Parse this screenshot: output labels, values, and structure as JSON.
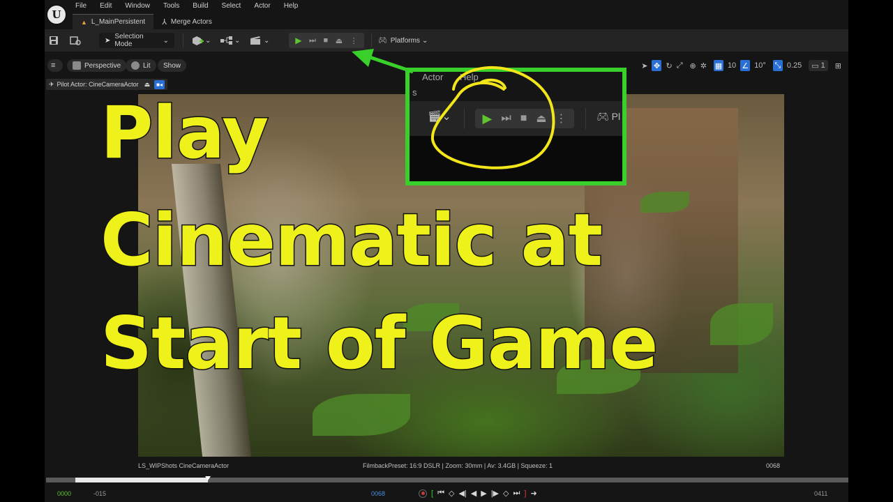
{
  "app": {
    "logo": "U",
    "menu": [
      "File",
      "Edit",
      "Window",
      "Tools",
      "Build",
      "Select",
      "Actor",
      "Help"
    ]
  },
  "tabs": [
    {
      "label": "L_MainPersistent",
      "icon": "warning-icon"
    },
    {
      "label": "Merge Actors",
      "icon": "merge-icon"
    }
  ],
  "toolbar": {
    "selection_mode": "Selection Mode",
    "platforms": "Platforms"
  },
  "viewport": {
    "perspective": "Perspective",
    "lit": "Lit",
    "show": "Show",
    "grid_value": "10",
    "angle_value": "10°",
    "scale_value": "0.25",
    "camera_value": "1",
    "pilot_actor": "Pilot Actor: CineCameraActor"
  },
  "status": {
    "shot": "LS_WIPShots  CineCameraActor",
    "filmback": "FilmbackPreset: 16:9 DSLR | Zoom: 30mm | Av: 3.4GB | Squeeze: 1",
    "frame": "0068"
  },
  "transport": {
    "start": "0000",
    "offset": "-015",
    "current": "0068",
    "end": "0411",
    "progress_fraction": 0.165
  },
  "callout": {
    "menu_a": "Actor",
    "menu_b": "Help",
    "stub": "s",
    "platforms_stub": "Pl"
  },
  "overlay": {
    "line1": "Play",
    "line2": "Cinematic at",
    "line3": "Start of Game"
  },
  "colors": {
    "play_green": "#5fc430",
    "callout_green": "#3ad02b",
    "title_yellow": "#eef11a",
    "accent_blue": "#2a6fd6"
  }
}
